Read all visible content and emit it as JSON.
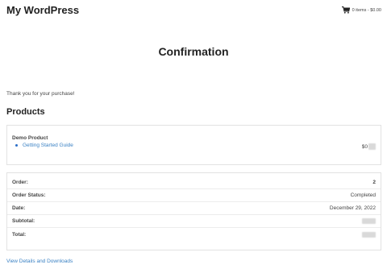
{
  "site": {
    "title": "My WordPress"
  },
  "cart": {
    "icon": "cart-icon",
    "summary": "0 items - $0.00"
  },
  "page": {
    "title": "Confirmation",
    "thanks": "Thank you for your purchase!"
  },
  "products": {
    "heading": "Products",
    "items": [
      {
        "name": "Demo Product",
        "download": "Getting Started Guide",
        "price_visible": "$0"
      }
    ]
  },
  "order": {
    "rows": [
      {
        "label": "Order:",
        "value": "2"
      },
      {
        "label": "Order Status:",
        "value": "Completed"
      },
      {
        "label": "Date:",
        "value": "December 29, 2022"
      },
      {
        "label": "Subtotal:",
        "value": ""
      },
      {
        "label": "Total:",
        "value": ""
      }
    ]
  },
  "links": {
    "view_details": "View Details and Downloads"
  },
  "colors": {
    "link": "#3b82c4",
    "border": "#e2e2e2",
    "text": "#444444"
  }
}
